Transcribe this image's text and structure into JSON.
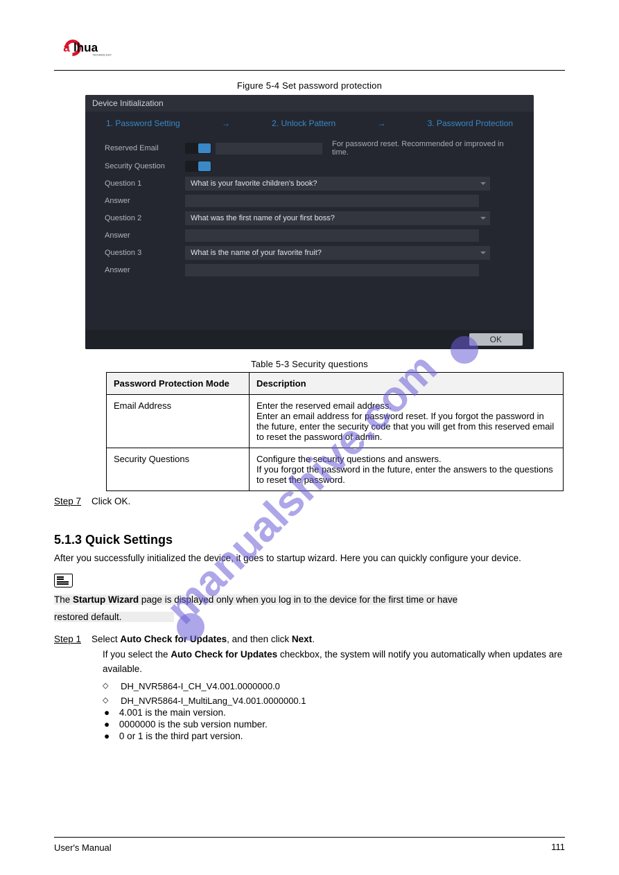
{
  "figure_caption": "Figure 5-4 Set password protection",
  "shot": {
    "window_title": "Device Initialization",
    "steps": {
      "s1": "1.   Password Setting",
      "s2": "2.   Unlock Pattern",
      "s3": "3.   Password Protection"
    },
    "labels": {
      "reserved_email": "Reserved Email",
      "security_question": "Security Question",
      "q1": "Question 1",
      "q2": "Question 2",
      "q3": "Question 3",
      "answer": "Answer"
    },
    "hint": "For password reset. Recommended or improved in time.",
    "q1_val": "What is your favorite children's book?",
    "q2_val": "What was the first name of your first boss?",
    "q3_val": "What is the name of your favorite fruit?",
    "ok": "OK"
  },
  "table_caption": "Table 5-3 Security questions",
  "table": {
    "h1": "Password Protection Mode",
    "h2": "Description",
    "r1c1": "Email Address",
    "r1c2_l1": "Enter the reserved email address.",
    "r1c2_l2": "Enter an email address for password reset. If you forgot the password in the future, enter the security code that you will get from this reserved email to reset the password of admin.",
    "r2c1": "Security Questions",
    "r2c2_l1": "Configure the security questions and answers.",
    "r2c2_l2": "If you forgot the password in the future, enter the answers to the questions to reset the password."
  },
  "step7_label": "Step 7",
  "step7_text": "Click OK.",
  "h3": "5.1.3 Quick Settings",
  "para": "After you successfully initialized the device, it goes to startup wizard. Here you can quickly configure your device.",
  "note": "The Startup Wizard page is displayed only when you log in to the device for the first time or have restored default.",
  "step1_label": "Step 1",
  "step1_text": "Select Auto Check for Updates, and then click Next.",
  "step1_sub": "If you select the Auto Check for Updates checkbox, the system will notify you automatically when updates are available.",
  "code_items": [
    "DH_NVR5864-I_CH_V4.001.0000000.0",
    "DH_NVR5864-I_MultiLang_V4.001.0000000.1"
  ],
  "bullets": [
    "4.001 is the main version.",
    "0000000 is the sub version number.",
    "0 or 1 is the third part version."
  ],
  "footer_left": "User's Manual",
  "footer_right": "111",
  "watermark_text": "manualshive.com"
}
